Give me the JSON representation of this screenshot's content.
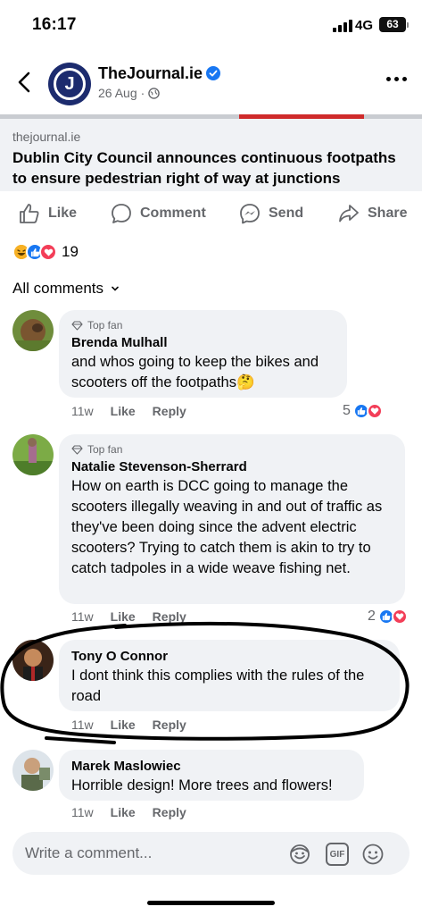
{
  "status_bar": {
    "time": "16:17",
    "network": "4G",
    "battery": "63"
  },
  "post": {
    "page_name": "TheJournal.ie",
    "page_logo_letter": "J",
    "date": "26 Aug",
    "link_domain": "thejournal.ie",
    "link_title": "Dublin City Council announces continuous footpaths to ensure pedestrian right of way at junctions",
    "reaction_count": "19"
  },
  "actions": {
    "like": "Like",
    "comment": "Comment",
    "send": "Send",
    "share": "Share"
  },
  "comments_sort": "All comments",
  "comments": [
    {
      "top_fan": "Top fan",
      "author": "Brenda Mulhall",
      "text": "and whos going to keep the bikes and scooters off the footpaths🤔",
      "time": "11w",
      "like": "Like",
      "reply": "Reply",
      "reactions": "5"
    },
    {
      "top_fan": "Top fan",
      "author": "Natalie Stevenson-Sherrard",
      "text": "How on earth is DCC going to manage the scooters illegally weaving in and out of traffic as they've been doing since the advent electric scooters? Trying to catch them is akin to try to catch tadpoles in a wide weave fishing net.",
      "time": "11w",
      "like": "Like",
      "reply": "Reply",
      "reactions": "2"
    },
    {
      "author": "Tony O Connor",
      "text": "I dont think this complies with the rules of the road",
      "time": "11w",
      "like": "Like",
      "reply": "Reply"
    },
    {
      "author": "Marek Maslowiec",
      "text": "Horrible design! More trees and flowers!",
      "time": "11w",
      "like": "Like",
      "reply": "Reply"
    }
  ],
  "composer": {
    "placeholder": "Write a comment...",
    "gif_label": "GIF"
  },
  "colors": {
    "like_blue": "#1877f2",
    "love_red": "#f33e58",
    "bubble_gray": "#f0f2f5",
    "meta_gray": "#65676b"
  }
}
